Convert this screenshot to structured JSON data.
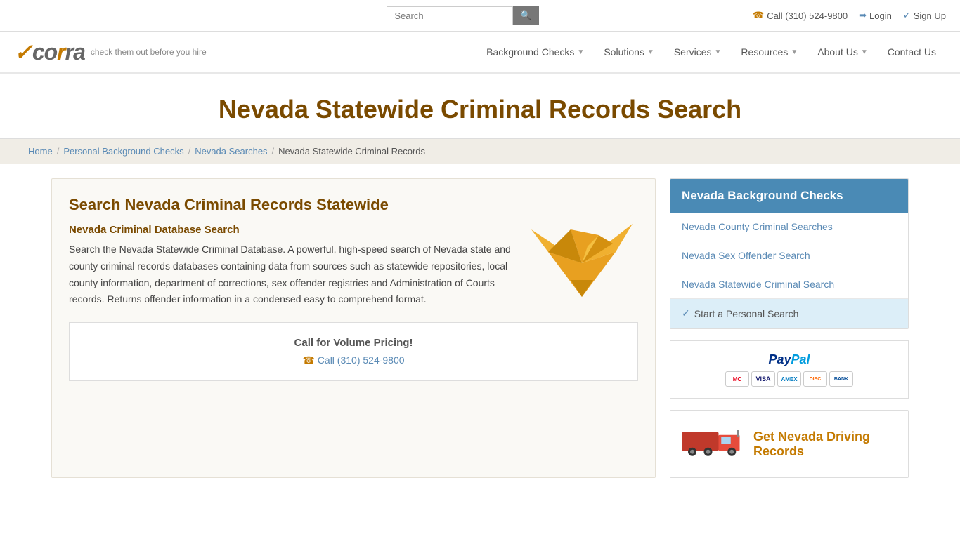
{
  "topbar": {
    "search_placeholder": "Search",
    "phone": "Call (310) 524-9800",
    "login": "Login",
    "signup": "Sign Up"
  },
  "header": {
    "logo_text": "✓corra",
    "tagline": "check them out before you hire",
    "nav": [
      {
        "label": "Background Checks",
        "has_caret": true
      },
      {
        "label": "Solutions",
        "has_caret": true
      },
      {
        "label": "Services",
        "has_caret": true
      },
      {
        "label": "Resources",
        "has_caret": true
      },
      {
        "label": "About Us",
        "has_caret": true
      },
      {
        "label": "Contact Us",
        "has_caret": false
      }
    ]
  },
  "page_title": "Nevada Statewide Criminal Records Search",
  "breadcrumb": {
    "items": [
      {
        "label": "Home",
        "link": true
      },
      {
        "label": "Personal Background Checks",
        "link": true
      },
      {
        "label": "Nevada Searches",
        "link": true
      },
      {
        "label": "Nevada Statewide Criminal Records",
        "link": false
      }
    ]
  },
  "main": {
    "heading": "Search Nevada Criminal Records Statewide",
    "sub_heading": "Nevada Criminal Database Search",
    "body_text": "Search the Nevada Statewide Criminal Database. A powerful, high-speed search of Nevada state and county criminal records databases containing data from sources such as statewide repositories, local county information, department of corrections, sex offender registries and Administration of Courts records. Returns offender information in a condensed easy to comprehend format.",
    "call_box": {
      "title": "Call for Volume Pricing!",
      "number": "Call (310) 524-9800"
    }
  },
  "sidebar": {
    "header": "Nevada Background Checks",
    "links": [
      {
        "label": "Nevada County Criminal Searches",
        "active": false
      },
      {
        "label": "Nevada Sex Offender Search",
        "active": false
      },
      {
        "label": "Nevada Statewide Criminal Search",
        "active": false
      },
      {
        "label": "Start a Personal Search",
        "is_cta": true
      }
    ],
    "paypal": {
      "label": "PayPal",
      "cards": [
        "MC",
        "VISA",
        "AMEX",
        "DISC",
        "BANK"
      ]
    },
    "driving": {
      "title": "Get Nevada Driving Records"
    }
  }
}
